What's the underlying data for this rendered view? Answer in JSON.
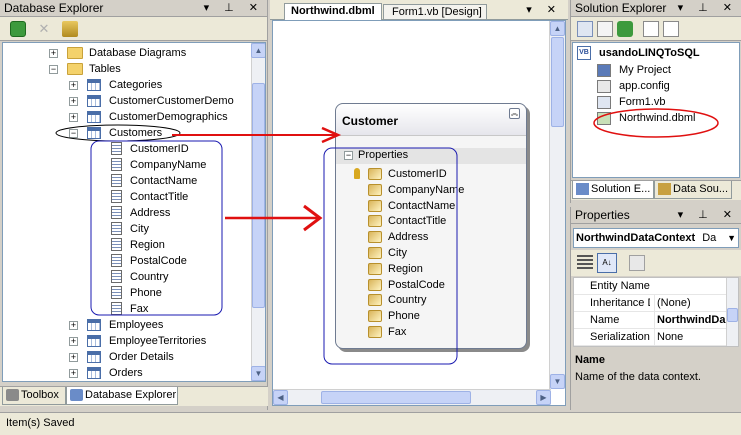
{
  "db_explorer": {
    "title": "Database Explorer",
    "tree": {
      "diagrams": "Database Diagrams",
      "tables": "Tables",
      "items_before": [
        "Categories",
        "CustomerCustomerDemo",
        "CustomerDemographics"
      ],
      "customers": "Customers",
      "columns": [
        "CustomerID",
        "CompanyName",
        "ContactName",
        "ContactTitle",
        "Address",
        "City",
        "Region",
        "PostalCode",
        "Country",
        "Phone",
        "Fax"
      ],
      "items_after": [
        "Employees",
        "EmployeeTerritories",
        "Order Details",
        "Orders"
      ]
    },
    "tabs": [
      "Toolbox",
      "Database Explorer"
    ]
  },
  "designer": {
    "tabs": [
      "Northwind.dbml",
      "Form1.vb [Design]"
    ],
    "entity": {
      "name": "Customer",
      "section": "Properties",
      "properties": [
        "CustomerID",
        "CompanyName",
        "ContactName",
        "ContactTitle",
        "Address",
        "City",
        "Region",
        "PostalCode",
        "Country",
        "Phone",
        "Fax"
      ]
    }
  },
  "solution_explorer": {
    "title": "Solution Explorer",
    "project": "usandoLINQToSQL",
    "items": [
      "My Project",
      "app.config",
      "Form1.vb",
      "Northwind.dbml"
    ],
    "tabs": [
      "Solution E...",
      "Data Sou..."
    ]
  },
  "properties": {
    "title": "Properties",
    "object": "NorthwindDataContext",
    "object_type": "Da",
    "rows": [
      {
        "name": "Entity Names",
        "value": ""
      },
      {
        "name": "Inheritance D",
        "value": "(None)"
      },
      {
        "name": "Name",
        "value": "NorthwindDa"
      },
      {
        "name": "Serialization",
        "value": "None"
      }
    ],
    "desc_title": "Name",
    "desc_text": "Name of the data context."
  },
  "statusbar": {
    "text": "Item(s) Saved"
  },
  "annotations": {
    "color": "#e01010",
    "outline_color": "#1a1ab0"
  }
}
